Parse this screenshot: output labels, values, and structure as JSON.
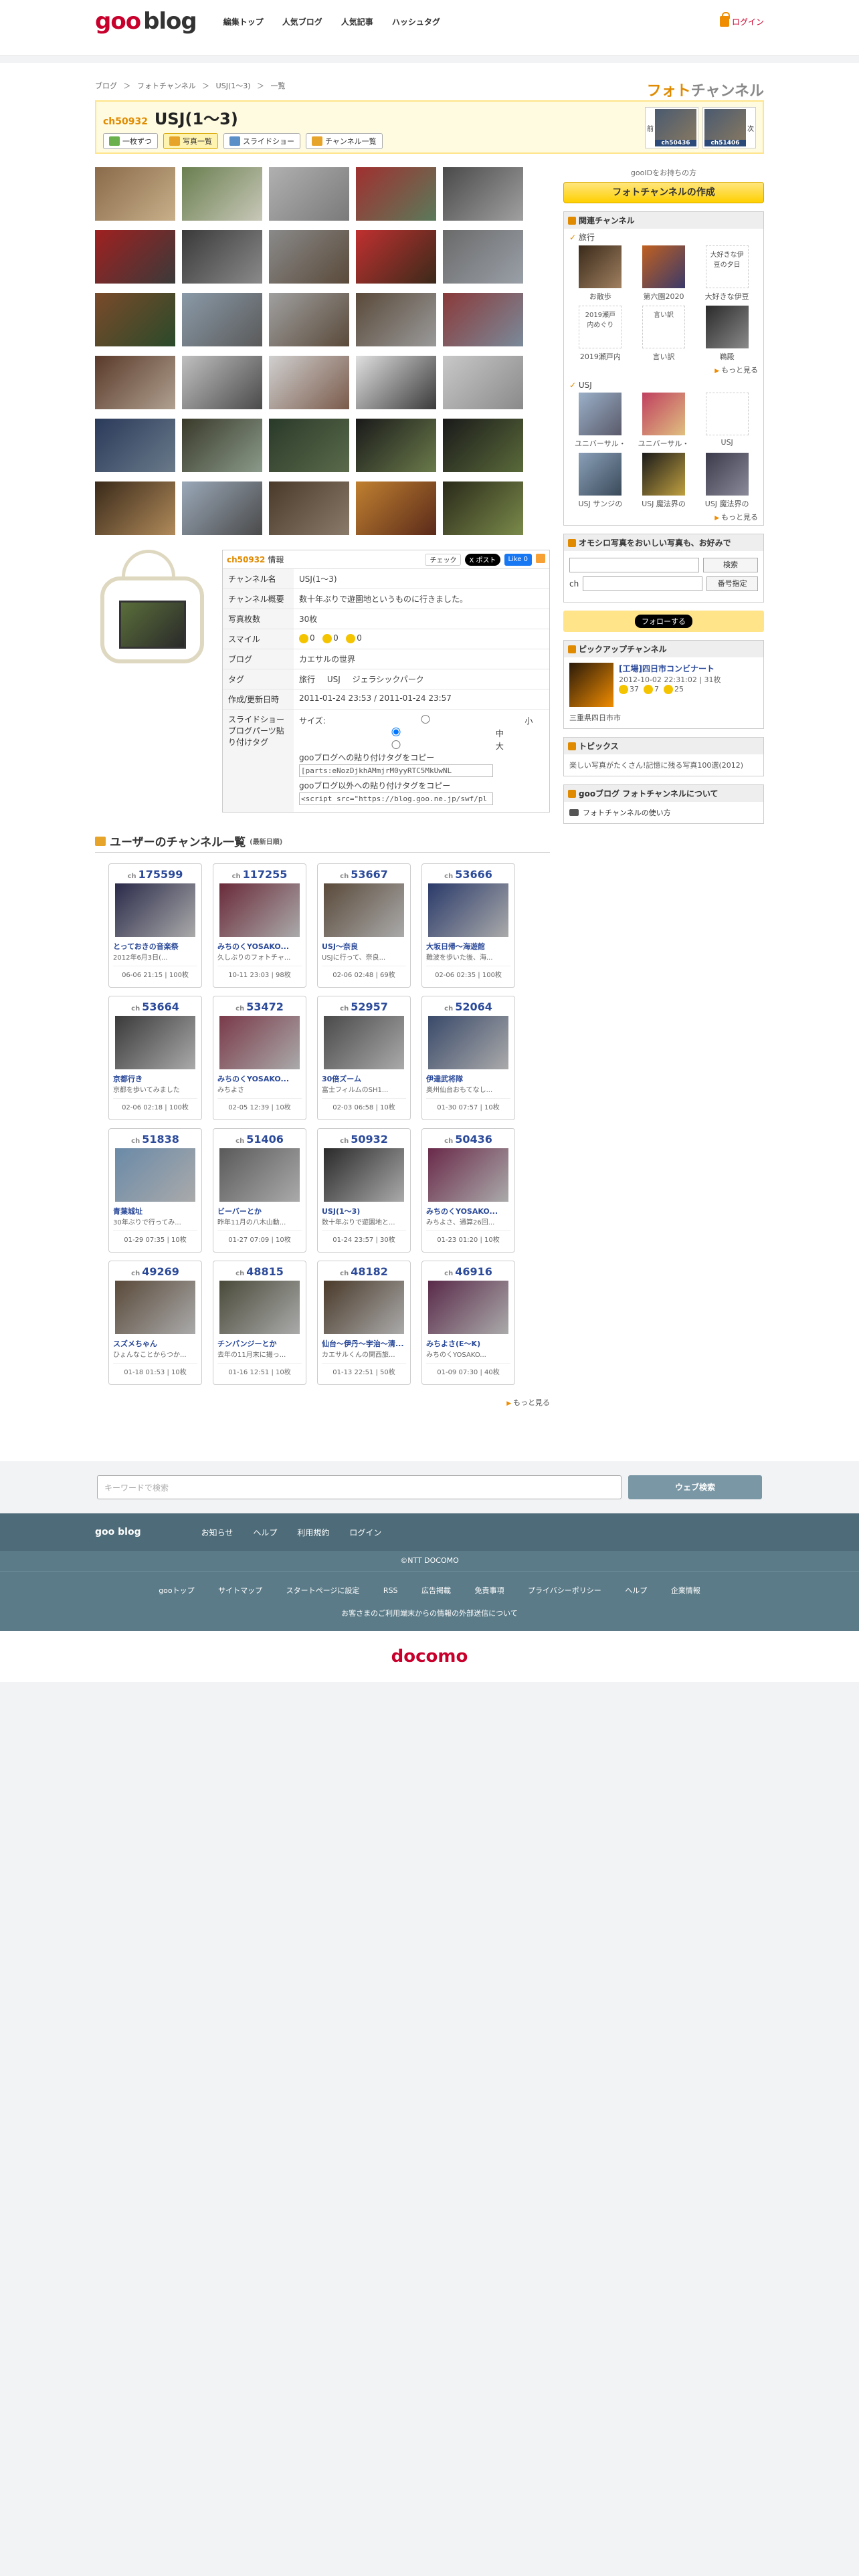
{
  "header": {
    "logo_goo": "goo",
    "logo_blog": "blog",
    "nav": [
      "編集トップ",
      "人気ブログ",
      "人気記事",
      "ハッシュタグ"
    ],
    "login": "ログイン"
  },
  "breadcrumb": [
    "ブログ",
    "＞",
    "フォトチャンネル",
    "＞",
    "USJ(1〜3)",
    "＞",
    "一覧"
  ],
  "section_label_photo": "フォト",
  "section_label_channel": "チャンネル",
  "channel": {
    "number": "ch50932",
    "title": "USJ(1〜3)",
    "buttons": [
      "一枚ずつ",
      "写真一覧",
      "スライドショー",
      "チャンネル一覧"
    ],
    "prev": "前",
    "next": "次",
    "prev_ch": "ch50436",
    "next_ch": "ch51406"
  },
  "info": {
    "head_ch": "ch50932",
    "head_label": "情報",
    "share": [
      "チェック",
      "X ポスト",
      "Like 0"
    ],
    "rows": {
      "channel_name_k": "チャンネル名",
      "channel_name_v": "USJ(1〜3)",
      "summary_k": "チャンネル概要",
      "summary_v": "数十年ぶりで遊園地というものに行きました。",
      "count_k": "写真枚数",
      "count_v": "30枚",
      "smile_k": "スマイル",
      "smile_v": [
        "0",
        "0",
        "0"
      ],
      "blog_k": "ブログ",
      "blog_v": "カエサルの世界",
      "tag_k": "タグ",
      "tags": [
        "旅行",
        "USJ",
        "ジェラシックパーク"
      ],
      "date_k": "作成/更新日時",
      "date_v": "2011-01-24 23:53 / 2011-01-24 23:57",
      "embed_k": "スライドショーブログパーツ貼り付けタグ",
      "size_label": "サイズ:",
      "sizes": [
        "小",
        "中",
        "大"
      ],
      "embed1_label": "gooブログへの貼り付けタグをコピー",
      "embed1_value": "[parts:eNozDjkhAMmjrM0yyRTC5MkUwNL",
      "embed2_label": "gooブログ以外への貼り付けタグをコピー",
      "embed2_value": "<script src=\"https://blog.goo.ne.jp/swf/pl"
    }
  },
  "users": {
    "title": "ユーザーのチャンネル一覧",
    "sub": "(最新日順)",
    "more": "もっと見る",
    "cards": [
      {
        "no": "175599",
        "title": "とっておきの音楽祭",
        "desc": "2012年6月3日(...",
        "meta": "06-06 21:15 | 100枚"
      },
      {
        "no": "117255",
        "title": "みちのくYOSAKO...",
        "desc": "久しぶりのフォトチャ...",
        "meta": "10-11 23:03 | 98枚"
      },
      {
        "no": "53667",
        "title": "USJ〜奈良",
        "desc": "USJに行って、奈良...",
        "meta": "02-06 02:48 | 69枚"
      },
      {
        "no": "53666",
        "title": "大坂日帰〜海遊館",
        "desc": "難波を歩いた後、海...",
        "meta": "02-06 02:35 | 100枚"
      },
      {
        "no": "53664",
        "title": "京都行き",
        "desc": "京都を歩いてみました",
        "meta": "02-06 02:18 | 100枚"
      },
      {
        "no": "53472",
        "title": "みちのくYOSAKO...",
        "desc": "みちよさ",
        "meta": "02-05 12:39 | 10枚"
      },
      {
        "no": "52957",
        "title": "30倍ズーム",
        "desc": "富士フィルムのSH1...",
        "meta": "02-03 06:58 | 10枚"
      },
      {
        "no": "52064",
        "title": "伊達武将隊",
        "desc": "奥州仙台おもてなし...",
        "meta": "01-30 07:57 | 10枚"
      },
      {
        "no": "51838",
        "title": "青葉城址",
        "desc": "30年ぶりで行ってみ...",
        "meta": "01-29 07:35 | 10枚"
      },
      {
        "no": "51406",
        "title": "ビーバーとか",
        "desc": "昨年11月の八木山動...",
        "meta": "01-27 07:09 | 10枚"
      },
      {
        "no": "50932",
        "title": "USJ(1〜3)",
        "desc": "数十年ぶりで遊園地と...",
        "meta": "01-24 23:57 | 30枚"
      },
      {
        "no": "50436",
        "title": "みちのくYOSAKO...",
        "desc": "みちよさ、通算26回...",
        "meta": "01-23 01:20 | 10枚"
      },
      {
        "no": "49269",
        "title": "スズメちゃん",
        "desc": "ひょんなことからつか...",
        "meta": "01-18 01:53 | 10枚"
      },
      {
        "no": "48815",
        "title": "チンパンジーとか",
        "desc": "去年の11月末に撮っ...",
        "meta": "01-16 12:51 | 10枚"
      },
      {
        "no": "48182",
        "title": "仙台〜伊丹〜宇治〜清...",
        "desc": "カエサルくんの関西旅...",
        "meta": "01-13 22:51 | 50枚"
      },
      {
        "no": "46916",
        "title": "みちよさ(E〜K)",
        "desc": "みちのくYOSAKO...",
        "meta": "01-09 07:30 | 40枚"
      }
    ]
  },
  "side": {
    "login_note": "gooIDをお持ちの方",
    "create": "フォトチャンネルの作成",
    "related_title": "関連チャンネル",
    "travel": "旅行",
    "travel_items": [
      "お散歩",
      "第六園2020",
      "大好きな伊豆",
      "2019瀬戸内",
      "言い訳",
      "鵜殿"
    ],
    "travel_alt": [
      "",
      "",
      "大好きな伊豆の夕日",
      "2019瀬戸内めぐり",
      "言い訳",
      ""
    ],
    "usj": "USJ",
    "usj_items": [
      "ユニバーサル・",
      "ユニバーサル・",
      "USJ",
      "USJ サンジの",
      "USJ 魔法界の",
      "USJ 魔法界の"
    ],
    "more": "もっと見る",
    "search_title": "オモシロ写真をおいしい写真も、お好みで",
    "search_btn": "検索",
    "ch_label": "ch",
    "ch_btn": "番号指定",
    "follow": "フォローする",
    "pickup_title": "ピックアップチャンネル",
    "pickup_t": "[工場]四日市コンビナート",
    "pickup_d": "2012-10-02 22:31:02 | 31枚",
    "pickup_smiles": [
      "37",
      "7",
      "25"
    ],
    "pickup_foot": "三重県四日市市",
    "topics_title": "トピックス",
    "topic": "楽しい写真がたくさん!記憶に残る写真100選(2012)",
    "about_title": "gooブログ フォトチャンネルについて",
    "about": "フォトチャンネルの使い方"
  },
  "footer": {
    "search_placeholder": "キーワードで検索",
    "search_btn": "ウェブ検索",
    "brand": "goo blog",
    "links1": [
      "お知らせ",
      "ヘルプ",
      "利用規約",
      "ログイン"
    ],
    "ntt": "©NTT DOCOMO",
    "links2": [
      "gooトップ",
      "サイトマップ",
      "スタートページに設定",
      "RSS",
      "広告掲載",
      "免責事項",
      "プライバシーポリシー",
      "ヘルプ",
      "企業情報"
    ],
    "note": "お客さまのご利用端末からの情報の外部送信について",
    "docomo": "docomo"
  },
  "colors": {
    "brand": "#c8002c",
    "accent": "#e08a00",
    "link": "#2b4a9a"
  }
}
